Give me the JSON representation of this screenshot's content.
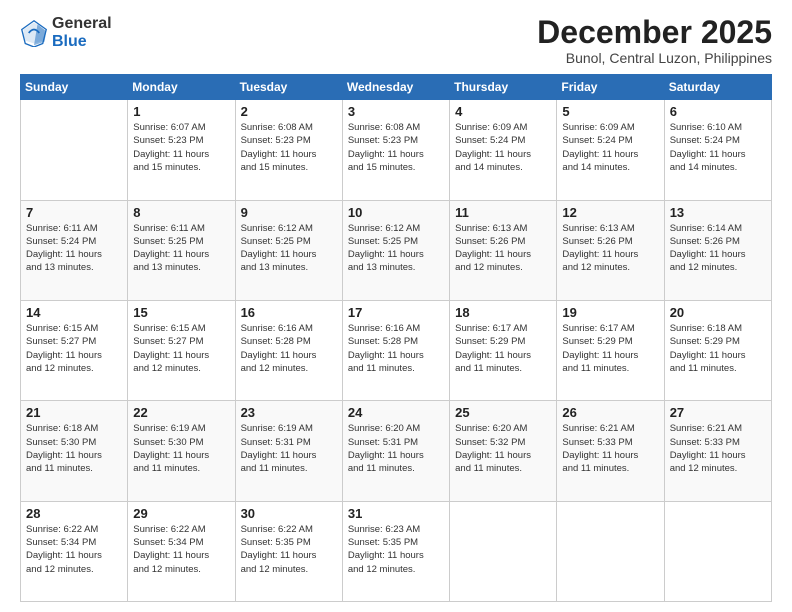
{
  "logo": {
    "general": "General",
    "blue": "Blue"
  },
  "header": {
    "month": "December 2025",
    "location": "Bunol, Central Luzon, Philippines"
  },
  "weekdays": [
    "Sunday",
    "Monday",
    "Tuesday",
    "Wednesday",
    "Thursday",
    "Friday",
    "Saturday"
  ],
  "weeks": [
    [
      {
        "day": "",
        "info": ""
      },
      {
        "day": "1",
        "info": "Sunrise: 6:07 AM\nSunset: 5:23 PM\nDaylight: 11 hours\nand 15 minutes."
      },
      {
        "day": "2",
        "info": "Sunrise: 6:08 AM\nSunset: 5:23 PM\nDaylight: 11 hours\nand 15 minutes."
      },
      {
        "day": "3",
        "info": "Sunrise: 6:08 AM\nSunset: 5:23 PM\nDaylight: 11 hours\nand 15 minutes."
      },
      {
        "day": "4",
        "info": "Sunrise: 6:09 AM\nSunset: 5:24 PM\nDaylight: 11 hours\nand 14 minutes."
      },
      {
        "day": "5",
        "info": "Sunrise: 6:09 AM\nSunset: 5:24 PM\nDaylight: 11 hours\nand 14 minutes."
      },
      {
        "day": "6",
        "info": "Sunrise: 6:10 AM\nSunset: 5:24 PM\nDaylight: 11 hours\nand 14 minutes."
      }
    ],
    [
      {
        "day": "7",
        "info": "Sunrise: 6:11 AM\nSunset: 5:24 PM\nDaylight: 11 hours\nand 13 minutes."
      },
      {
        "day": "8",
        "info": "Sunrise: 6:11 AM\nSunset: 5:25 PM\nDaylight: 11 hours\nand 13 minutes."
      },
      {
        "day": "9",
        "info": "Sunrise: 6:12 AM\nSunset: 5:25 PM\nDaylight: 11 hours\nand 13 minutes."
      },
      {
        "day": "10",
        "info": "Sunrise: 6:12 AM\nSunset: 5:25 PM\nDaylight: 11 hours\nand 13 minutes."
      },
      {
        "day": "11",
        "info": "Sunrise: 6:13 AM\nSunset: 5:26 PM\nDaylight: 11 hours\nand 12 minutes."
      },
      {
        "day": "12",
        "info": "Sunrise: 6:13 AM\nSunset: 5:26 PM\nDaylight: 11 hours\nand 12 minutes."
      },
      {
        "day": "13",
        "info": "Sunrise: 6:14 AM\nSunset: 5:26 PM\nDaylight: 11 hours\nand 12 minutes."
      }
    ],
    [
      {
        "day": "14",
        "info": "Sunrise: 6:15 AM\nSunset: 5:27 PM\nDaylight: 11 hours\nand 12 minutes."
      },
      {
        "day": "15",
        "info": "Sunrise: 6:15 AM\nSunset: 5:27 PM\nDaylight: 11 hours\nand 12 minutes."
      },
      {
        "day": "16",
        "info": "Sunrise: 6:16 AM\nSunset: 5:28 PM\nDaylight: 11 hours\nand 12 minutes."
      },
      {
        "day": "17",
        "info": "Sunrise: 6:16 AM\nSunset: 5:28 PM\nDaylight: 11 hours\nand 11 minutes."
      },
      {
        "day": "18",
        "info": "Sunrise: 6:17 AM\nSunset: 5:29 PM\nDaylight: 11 hours\nand 11 minutes."
      },
      {
        "day": "19",
        "info": "Sunrise: 6:17 AM\nSunset: 5:29 PM\nDaylight: 11 hours\nand 11 minutes."
      },
      {
        "day": "20",
        "info": "Sunrise: 6:18 AM\nSunset: 5:29 PM\nDaylight: 11 hours\nand 11 minutes."
      }
    ],
    [
      {
        "day": "21",
        "info": "Sunrise: 6:18 AM\nSunset: 5:30 PM\nDaylight: 11 hours\nand 11 minutes."
      },
      {
        "day": "22",
        "info": "Sunrise: 6:19 AM\nSunset: 5:30 PM\nDaylight: 11 hours\nand 11 minutes."
      },
      {
        "day": "23",
        "info": "Sunrise: 6:19 AM\nSunset: 5:31 PM\nDaylight: 11 hours\nand 11 minutes."
      },
      {
        "day": "24",
        "info": "Sunrise: 6:20 AM\nSunset: 5:31 PM\nDaylight: 11 hours\nand 11 minutes."
      },
      {
        "day": "25",
        "info": "Sunrise: 6:20 AM\nSunset: 5:32 PM\nDaylight: 11 hours\nand 11 minutes."
      },
      {
        "day": "26",
        "info": "Sunrise: 6:21 AM\nSunset: 5:33 PM\nDaylight: 11 hours\nand 11 minutes."
      },
      {
        "day": "27",
        "info": "Sunrise: 6:21 AM\nSunset: 5:33 PM\nDaylight: 11 hours\nand 12 minutes."
      }
    ],
    [
      {
        "day": "28",
        "info": "Sunrise: 6:22 AM\nSunset: 5:34 PM\nDaylight: 11 hours\nand 12 minutes."
      },
      {
        "day": "29",
        "info": "Sunrise: 6:22 AM\nSunset: 5:34 PM\nDaylight: 11 hours\nand 12 minutes."
      },
      {
        "day": "30",
        "info": "Sunrise: 6:22 AM\nSunset: 5:35 PM\nDaylight: 11 hours\nand 12 minutes."
      },
      {
        "day": "31",
        "info": "Sunrise: 6:23 AM\nSunset: 5:35 PM\nDaylight: 11 hours\nand 12 minutes."
      },
      {
        "day": "",
        "info": ""
      },
      {
        "day": "",
        "info": ""
      },
      {
        "day": "",
        "info": ""
      }
    ]
  ]
}
